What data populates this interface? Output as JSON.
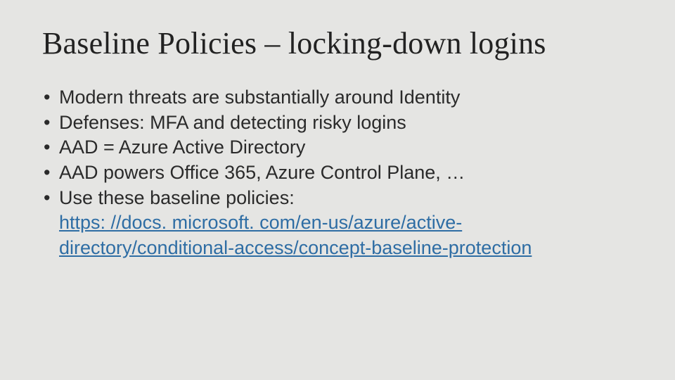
{
  "slide": {
    "title": "Baseline Policies – locking-down logins",
    "bullets": [
      {
        "text": "Modern threats are substantially around Identity"
      },
      {
        "text": "Defenses: MFA and detecting risky logins"
      },
      {
        "text": "AAD = Azure Active Directory"
      },
      {
        "text": "AAD powers Office 365, Azure Control Plane, …"
      },
      {
        "text": "Use these baseline policies: ",
        "link_text": "https: //docs. microsoft. com/en-us/azure/active-directory/conditional-access/concept-baseline-protection",
        "link_href": "https://docs.microsoft.com/en-us/azure/active-directory/conditional-access/concept-baseline-protection"
      }
    ],
    "colors": {
      "background": "#e5e5e3",
      "text": "#2a2a2a",
      "link": "#2e6da4"
    }
  }
}
